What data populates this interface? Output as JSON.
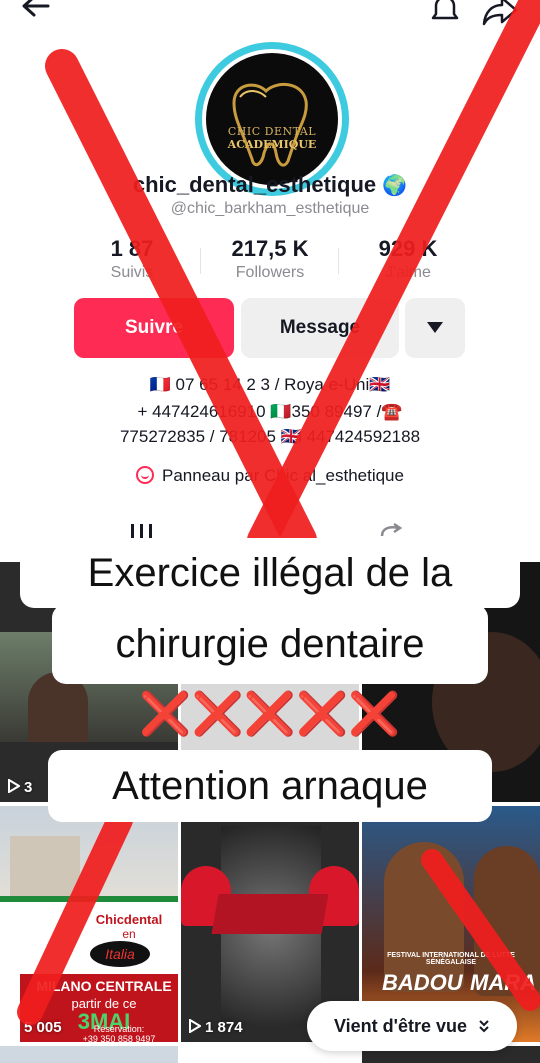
{
  "profile": {
    "avatar_text_line1": "CHIC DENTAL",
    "avatar_text_line2": "ACADEMIQUE",
    "username": "chic_dental_esthetique",
    "username_badge": "🌍",
    "handle": "@chic_barkham_esthetique"
  },
  "stats": [
    {
      "value": "1 87",
      "label": "Suivis"
    },
    {
      "value": "217,5 K",
      "label": "Followers"
    },
    {
      "value": "929 K",
      "label": "J'aime"
    }
  ],
  "actions": {
    "follow_label": "Suivre",
    "message_label": "Message"
  },
  "bio": {
    "line1": "🇫🇷 07 65 14 2  3 / Roya   e-Uni🇬🇧",
    "line2": "+ 447424616910   🇮🇹350   89497 /☎️",
    "line3": "775272835 / 781205   🇬🇧 447424592188"
  },
  "showcase": {
    "label": "Panneau par Chic   al_esthetique"
  },
  "overlay": {
    "line1": "Exercice illégal de la",
    "line2": "chirurgie dentaire",
    "marks": "❌❌❌❌❌",
    "line3": "Attention arnaque"
  },
  "videos": [
    {
      "views": "3",
      "caption": ""
    },
    {
      "views": "5 005",
      "caption_top": "Chicdental",
      "caption_mid": "en",
      "caption_italia": "Italia",
      "caption_city": "MILANO CENTRALE",
      "caption_from": "partir de ce",
      "caption_date": "3MAI",
      "caption_res": "Réservation:",
      "caption_phone": "+39 350 858 9497"
    },
    {
      "views": "1 874"
    },
    {
      "views": "",
      "caption_name": "BADOU",
      "caption_name2": "MARA",
      "caption_fest": "FESTIVAL INTERNATIONAL DE LUTTE SÉNÉGALAISE"
    }
  ],
  "recent_label": "Vient d'être vue",
  "colors": {
    "accent": "#fe2c55",
    "avatar_ring": "#3ecbe0",
    "cross": "#f01e1e"
  },
  "icons": [
    "back-arrow-icon",
    "bell-icon",
    "share-icon",
    "dropdown-triangle-icon",
    "showcase-icon",
    "play-icon",
    "chevron-double-down-icon"
  ]
}
